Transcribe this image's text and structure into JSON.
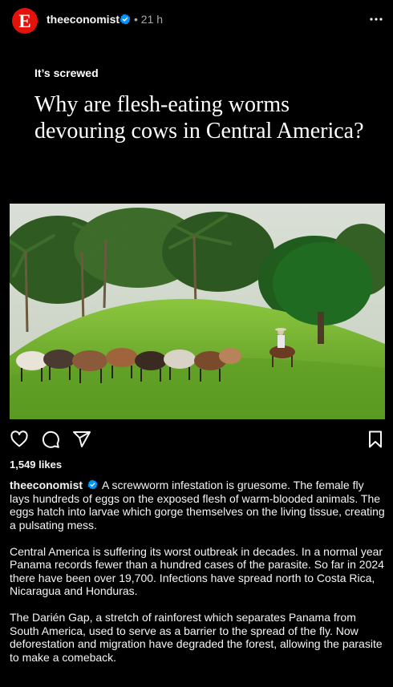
{
  "post": {
    "avatar_letter": "E",
    "username": "theeconomist",
    "time": "21 h",
    "kicker": "It’s screwed",
    "headline": "Why are flesh-eating worms devouring cows in Central America?",
    "likes": "1,549 likes",
    "caption_user": "theeconomist",
    "caption_paragraphs": [
      "A screwworm infestation is gruesome. The female fly lays hundreds of eggs on the exposed flesh of warm-blooded animals. The eggs hatch into larvae which gorge themselves on the living tissue, creating a pulsating mess.",
      "Central America is suffering its worst outbreak in decades. In a normal year Panama records fewer than a hundred cases of the parasite. So far in 2024 there have been over 19,700. Infections have spread north to Costa Rica, Nicaragua and Honduras.",
      "The Darién Gap, a stretch of rainforest which separates Panama from South America, used to serve as a barrier to the spread of the fly. Now deforestation and migration have degraded the forest, allowing the parasite to make a comeback."
    ]
  },
  "icons": {
    "verified": "verified-badge-icon",
    "more": "more-options-icon",
    "like": "heart-icon",
    "comment": "comment-icon",
    "share": "send-icon",
    "save": "bookmark-icon"
  },
  "colors": {
    "brand_red": "#e3120b",
    "verified_blue": "#0095f6",
    "background": "#000000",
    "muted_text": "#a8a8a8"
  }
}
